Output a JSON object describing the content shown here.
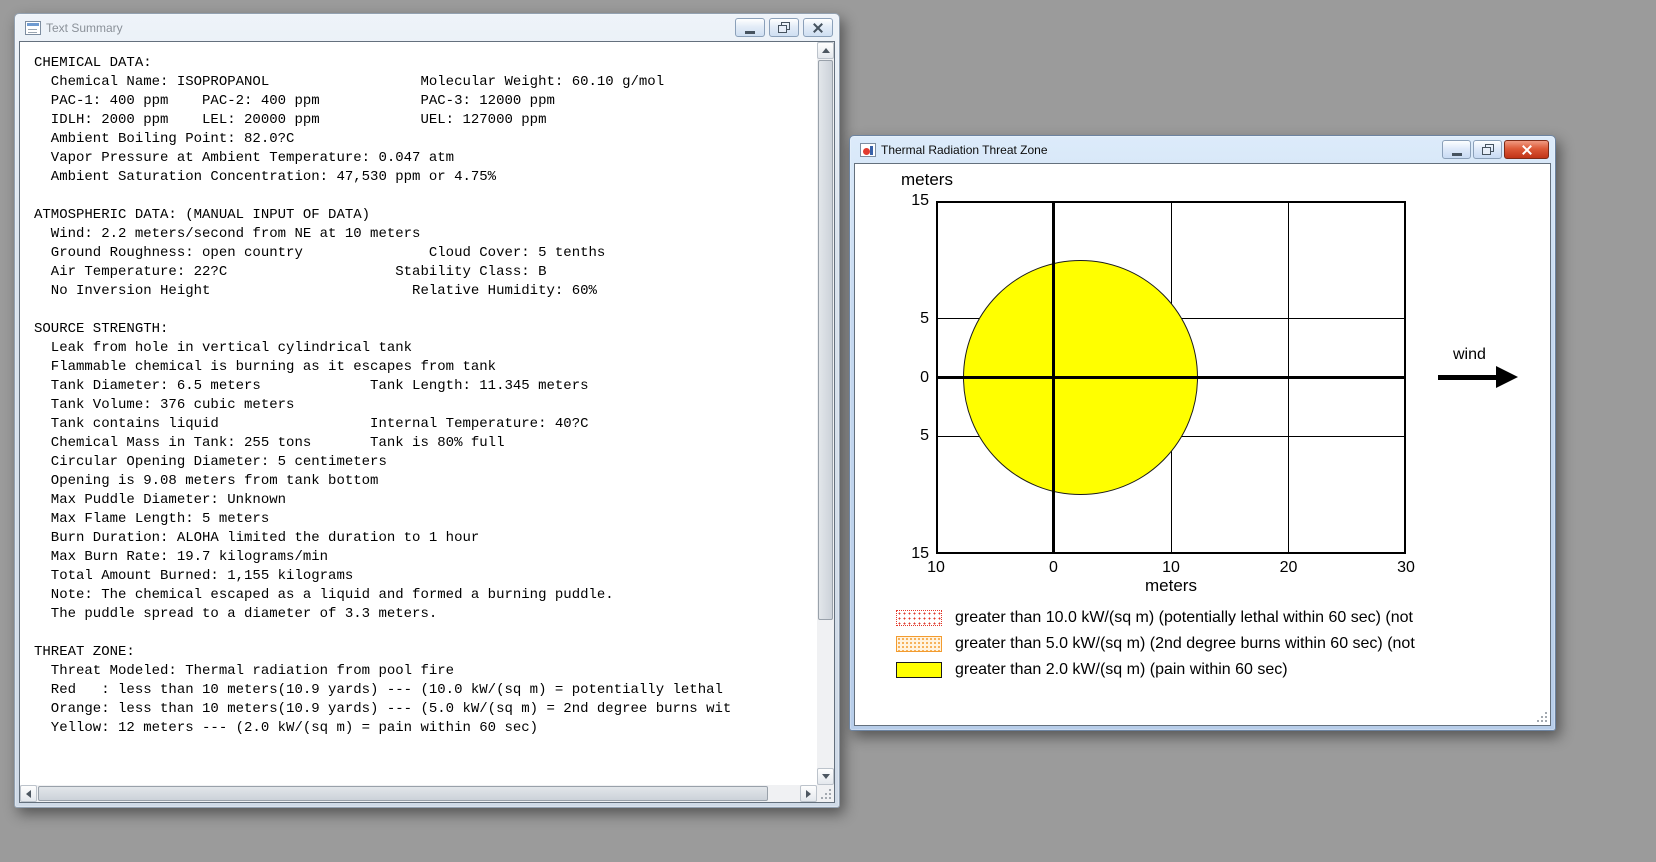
{
  "desktop": {
    "background_color": "#9b9b9b"
  },
  "text_summary_window": {
    "title": "Text Summary",
    "caption_buttons": [
      "minimize",
      "restore",
      "close"
    ],
    "lines": [
      "CHEMICAL DATA:",
      "  Chemical Name: ISOPROPANOL                  Molecular Weight: 60.10 g/mol",
      "  PAC-1: 400 ppm    PAC-2: 400 ppm            PAC-3: 12000 ppm",
      "  IDLH: 2000 ppm    LEL: 20000 ppm            UEL: 127000 ppm",
      "  Ambient Boiling Point: 82.0?C",
      "  Vapor Pressure at Ambient Temperature: 0.047 atm",
      "  Ambient Saturation Concentration: 47,530 ppm or 4.75%",
      "",
      "ATMOSPHERIC DATA: (MANUAL INPUT OF DATA)",
      "  Wind: 2.2 meters/second from NE at 10 meters",
      "  Ground Roughness: open country               Cloud Cover: 5 tenths",
      "  Air Temperature: 22?C                    Stability Class: B",
      "  No Inversion Height                        Relative Humidity: 60%",
      "",
      "SOURCE STRENGTH:",
      "  Leak from hole in vertical cylindrical tank",
      "  Flammable chemical is burning as it escapes from tank",
      "  Tank Diameter: 6.5 meters             Tank Length: 11.345 meters",
      "  Tank Volume: 376 cubic meters",
      "  Tank contains liquid                  Internal Temperature: 40?C",
      "  Chemical Mass in Tank: 255 tons       Tank is 80% full",
      "  Circular Opening Diameter: 5 centimeters",
      "  Opening is 9.08 meters from tank bottom",
      "  Max Puddle Diameter: Unknown",
      "  Max Flame Length: 5 meters",
      "  Burn Duration: ALOHA limited the duration to 1 hour",
      "  Max Burn Rate: 19.7 kilograms/min",
      "  Total Amount Burned: 1,155 kilograms",
      "  Note: The chemical escaped as a liquid and formed a burning puddle.",
      "  The puddle spread to a diameter of 3.3 meters.",
      "",
      "THREAT ZONE:",
      "  Threat Modeled: Thermal radiation from pool fire",
      "  Red   : less than 10 meters(10.9 yards) --- (10.0 kW/(sq m) = potentially lethal",
      "  Orange: less than 10 meters(10.9 yards) --- (5.0 kW/(sq m) = 2nd degree burns wit",
      "  Yellow: 12 meters --- (2.0 kW/(sq m) = pain within 60 sec)"
    ]
  },
  "threat_zone_window": {
    "title": "Thermal Radiation Threat Zone",
    "caption_buttons": [
      "minimize",
      "restore",
      "close"
    ],
    "y_axis_label": "meters",
    "x_axis_label": "meters",
    "wind_label": "wind",
    "legend": [
      {
        "swatch": "red-dotted",
        "color": "#e2382a",
        "label": "greater than 10.0 kW/(sq m) (potentially lethal within 60 sec) (not"
      },
      {
        "swatch": "orange-dotted",
        "color": "#f39c2f",
        "label": "greater than 5.0 kW/(sq m) (2nd degree burns within 60 sec) (not"
      },
      {
        "swatch": "yellow-solid",
        "color": "#ffff00",
        "label": "greater than 2.0 kW/(sq m) (pain within 60 sec)"
      }
    ]
  },
  "chart_data": {
    "type": "area",
    "title": "Thermal Radiation Threat Zone",
    "xlabel": "meters",
    "ylabel": "meters",
    "xlim": [
      -10,
      30
    ],
    "ylim": [
      -15,
      15
    ],
    "grid": true,
    "x_ticks": [
      {
        "value": -10,
        "label": "10",
        "grid": "edge"
      },
      {
        "value": 0,
        "label": "0",
        "grid": "axis"
      },
      {
        "value": 10,
        "label": "10",
        "grid": "thin"
      },
      {
        "value": 20,
        "label": "20",
        "grid": "thin"
      },
      {
        "value": 30,
        "label": "30",
        "grid": "edge"
      }
    ],
    "y_ticks": [
      {
        "value": 15,
        "label": "15",
        "grid": "edge"
      },
      {
        "value": 5,
        "label": "5",
        "grid": "thin"
      },
      {
        "value": 0,
        "label": "0",
        "grid": "axis"
      },
      {
        "value": -5,
        "label": "5",
        "grid": "thin"
      },
      {
        "value": -15,
        "label": "15",
        "grid": "edge"
      }
    ],
    "zones": [
      {
        "name": "yellow-threat-zone",
        "threshold": "2.0 kW/(sq m)",
        "shape": "circle",
        "center_m": [
          2.3,
          0
        ],
        "radius_m": 10,
        "fill": "#ffff00"
      }
    ],
    "wind": {
      "label": "wind",
      "direction": "left-to-right"
    }
  }
}
